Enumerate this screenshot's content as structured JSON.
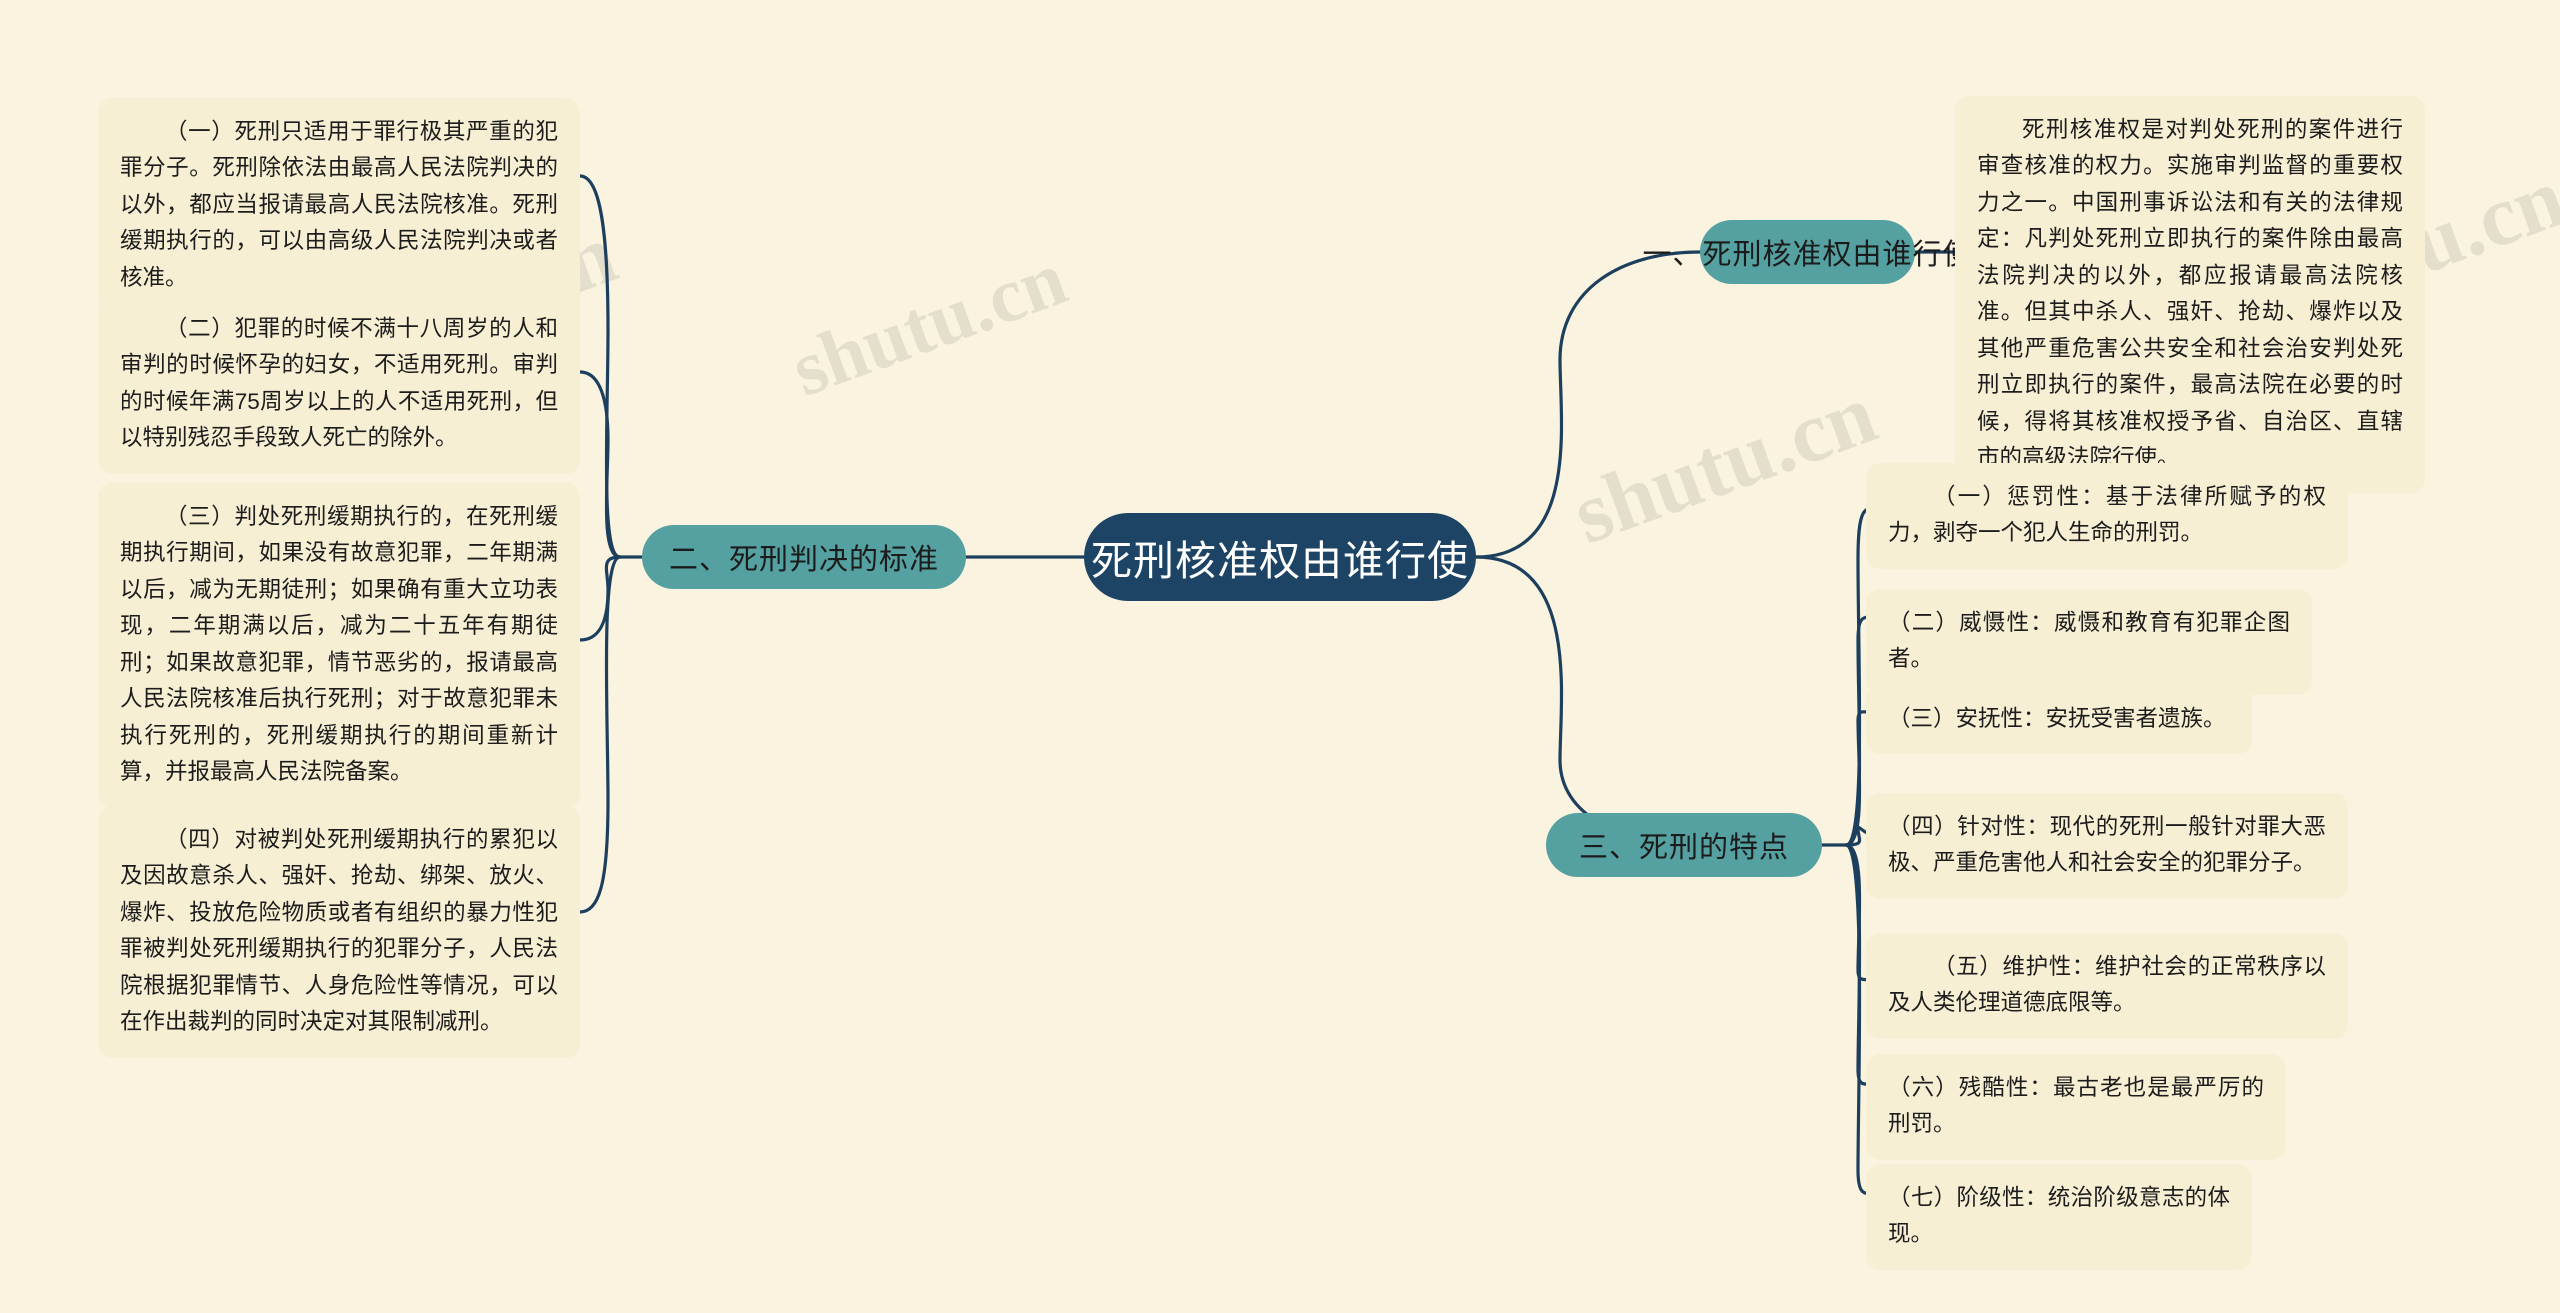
{
  "colors": {
    "background": "#faf3df",
    "root_fill": "#1d4464",
    "root_text": "#ffffff",
    "branch_fill": "#55a0a0",
    "branch_text": "#1b1b1b",
    "leaf_fill": "#f7efd4",
    "leaf_text": "#1c1c1c",
    "connector": "#1d3f5e"
  },
  "watermarks": {
    "a": "shutu.cn",
    "b": "shutu.cn",
    "c": "shutu.cn",
    "d": "树图 shutu.cn"
  },
  "mindmap": {
    "root": {
      "label": "死刑核准权由谁行使"
    },
    "branches": [
      {
        "id": "branch-1",
        "label": "一、死刑核准权由谁行使",
        "leaves": [
          {
            "id": "leaf-1-1",
            "text": "死刑核准权是对判处死刑的案件进行审查核准的权力。实施审判监督的重要权力之一。中国刑事诉讼法和有关的法律规定：凡判处死刑立即执行的案件除由最高法院判决的以外，都应报请最高法院核准。但其中杀人、强奸、抢劫、爆炸以及其他严重危害公共安全和社会治安判处死刑立即执行的案件，最高法院在必要的时候，得将其核准权授予省、自治区、直辖市的高级法院行使。"
          }
        ]
      },
      {
        "id": "branch-2",
        "label": "二、死刑判决的标准",
        "leaves": [
          {
            "id": "leaf-2-1",
            "text": "（一）死刑只适用于罪行极其严重的犯罪分子。死刑除依法由最高人民法院判决的以外，都应当报请最高人民法院核准。死刑缓期执行的，可以由高级人民法院判决或者核准。"
          },
          {
            "id": "leaf-2-2",
            "text": "（二）犯罪的时候不满十八周岁的人和审判的时候怀孕的妇女，不适用死刑。审判的时候年满75周岁以上的人不适用死刑，但以特别残忍手段致人死亡的除外。"
          },
          {
            "id": "leaf-2-3",
            "text": "（三）判处死刑缓期执行的，在死刑缓期执行期间，如果没有故意犯罪，二年期满以后，减为无期徒刑；如果确有重大立功表现，二年期满以后，减为二十五年有期徒刑；如果故意犯罪，情节恶劣的，报请最高人民法院核准后执行死刑；对于故意犯罪未执行死刑的，死刑缓期执行的期间重新计算，并报最高人民法院备案。"
          },
          {
            "id": "leaf-2-4",
            "text": "（四）对被判处死刑缓期执行的累犯以及因故意杀人、强奸、抢劫、绑架、放火、爆炸、投放危险物质或者有组织的暴力性犯罪被判处死刑缓期执行的犯罪分子，人民法院根据犯罪情节、人身危险性等情况，可以在作出裁判的同时决定对其限制减刑。"
          }
        ]
      },
      {
        "id": "branch-3",
        "label": "三、死刑的特点",
        "leaves": [
          {
            "id": "leaf-3-1",
            "text": "（一）惩罚性：基于法律所赋予的权力，剥夺一个犯人生命的刑罚。"
          },
          {
            "id": "leaf-3-2",
            "text": "（二）威慑性：威慑和教育有犯罪企图者。"
          },
          {
            "id": "leaf-3-3",
            "text": "（三）安抚性：安抚受害者遗族。"
          },
          {
            "id": "leaf-3-4",
            "text": "（四）针对性：现代的死刑一般针对罪大恶极、严重危害他人和社会安全的犯罪分子。"
          },
          {
            "id": "leaf-3-5",
            "text": "（五）维护性：维护社会的正常秩序以及人类伦理道德底限等。"
          },
          {
            "id": "leaf-3-6",
            "text": "（六）残酷性：最古老也是最严厉的刑罚。"
          },
          {
            "id": "leaf-3-7",
            "text": "（七）阶级性：统治阶级意志的体现。"
          }
        ]
      }
    ]
  }
}
